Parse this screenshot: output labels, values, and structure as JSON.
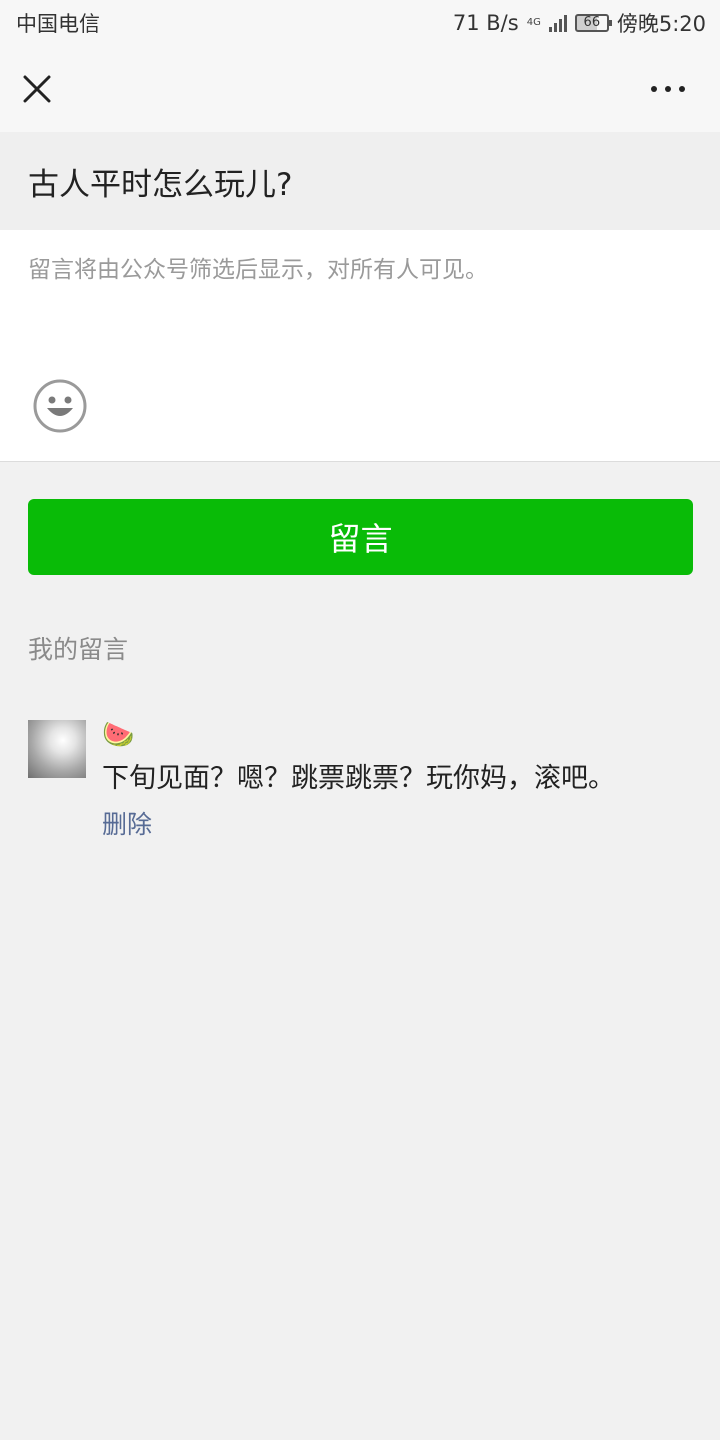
{
  "status_bar": {
    "carrier": "中国电信",
    "net_speed": "71 B/s",
    "network_type": "4G",
    "battery": "66",
    "time": "傍晚5:20"
  },
  "nav": {
    "close_icon": "close-icon",
    "more_icon": "more-dots-icon"
  },
  "article": {
    "title": "古人平时怎么玩儿?"
  },
  "compose": {
    "placeholder": "留言将由公众号筛选后显示，对所有人可见。",
    "value": "",
    "emoji_icon": "smiley-icon"
  },
  "submit": {
    "label": "留言",
    "color": "#09bb07"
  },
  "my_comments": {
    "title": "我的留言",
    "items": [
      {
        "nickname": "🍉",
        "text": "下旬见面？嗯？跳票跳票？玩你妈，滚吧。",
        "delete_label": "删除"
      }
    ]
  },
  "colors": {
    "link": "#576b95",
    "background": "#f1f1f1"
  }
}
